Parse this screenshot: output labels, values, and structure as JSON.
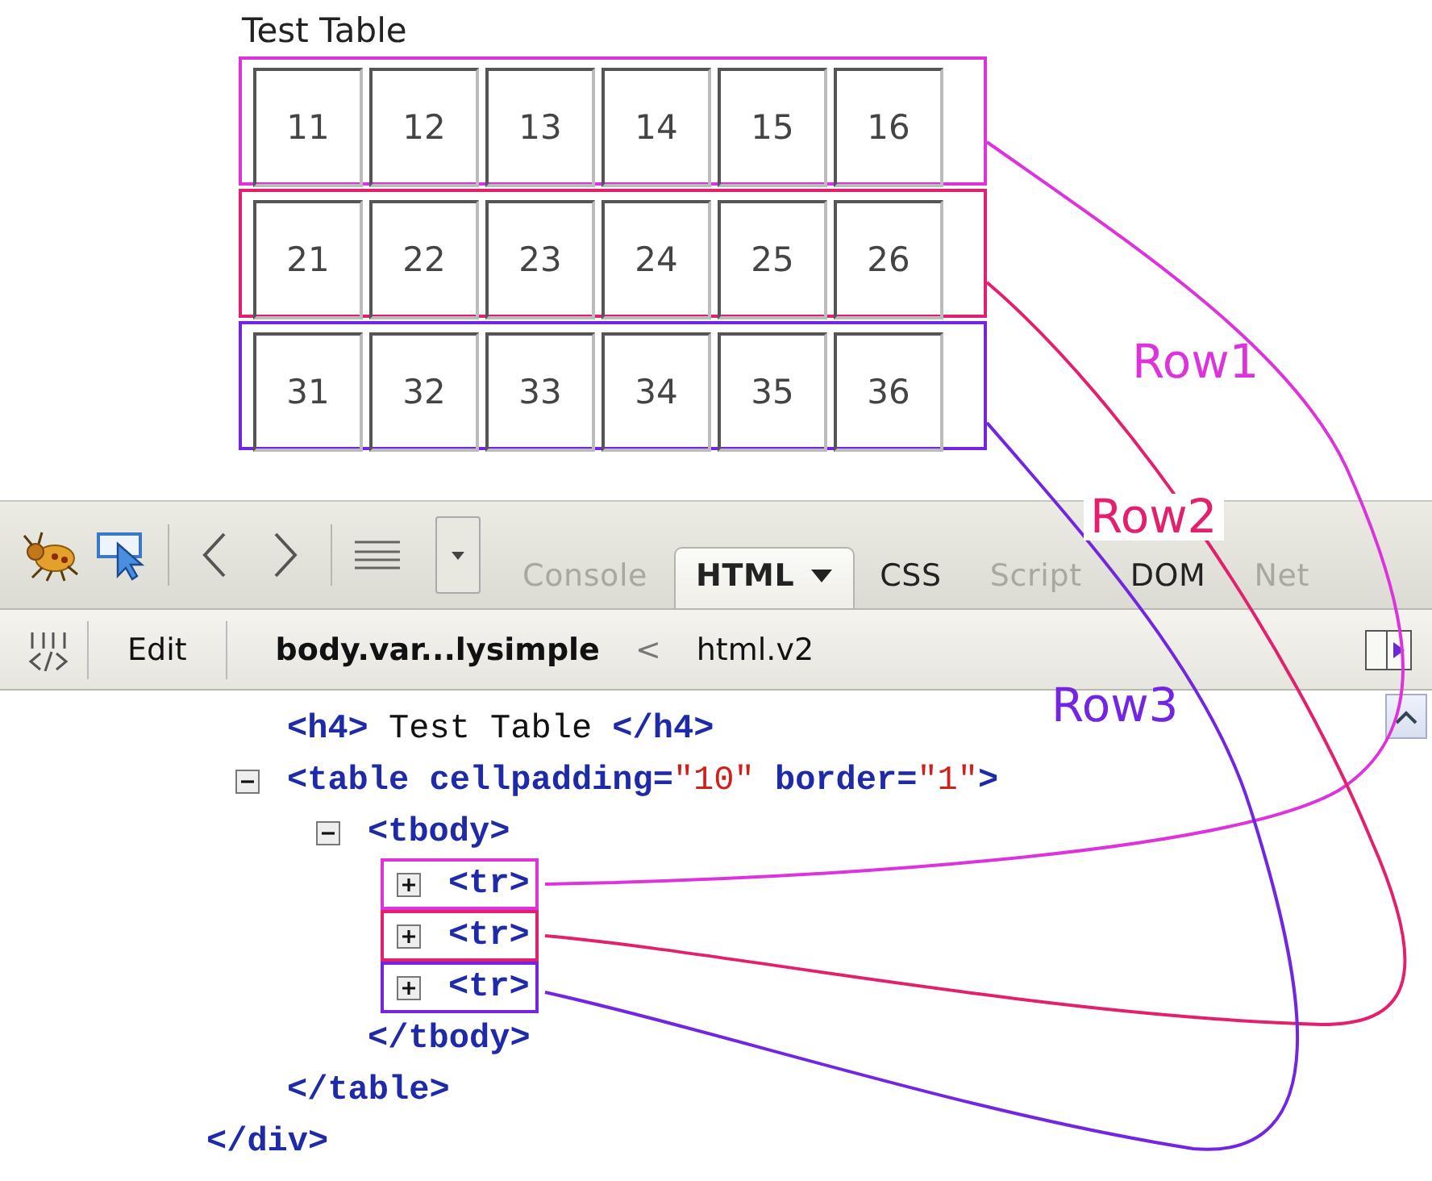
{
  "test_page": {
    "heading": "Test Table",
    "rows": [
      {
        "cells": [
          "11",
          "12",
          "13",
          "14",
          "15",
          "16"
        ]
      },
      {
        "cells": [
          "21",
          "22",
          "23",
          "24",
          "25",
          "26"
        ]
      },
      {
        "cells": [
          "31",
          "32",
          "33",
          "34",
          "35",
          "36"
        ]
      }
    ]
  },
  "toolbar": {
    "tabs": [
      {
        "label": "Console",
        "selected": false,
        "dimmed": true,
        "has_menu": false
      },
      {
        "label": "HTML",
        "selected": true,
        "dimmed": false,
        "has_menu": true
      },
      {
        "label": "CSS",
        "selected": false,
        "dimmed": false,
        "has_menu": false
      },
      {
        "label": "Script",
        "selected": false,
        "dimmed": true,
        "has_menu": false
      },
      {
        "label": "DOM",
        "selected": false,
        "dimmed": false,
        "has_menu": false
      },
      {
        "label": "Net",
        "selected": false,
        "dimmed": true,
        "has_menu": false
      }
    ]
  },
  "breadcrumbs": {
    "edit_button": "Edit",
    "crumbs": [
      "body.var...lysimple",
      "html.v2"
    ],
    "separator": "<"
  },
  "html_tree": {
    "close": [
      {
        "kind": "tag",
        "text": "</div>"
      }
    ],
    "children": [
      {
        "open": [
          {
            "kind": "tag",
            "text": "<h4>"
          },
          {
            "kind": "text",
            "text": " Test Table "
          },
          {
            "kind": "tag",
            "text": "</h4>"
          }
        ]
      },
      {
        "open": [
          {
            "kind": "tag",
            "text": "<table"
          },
          {
            "kind": "attr",
            "text": " cellpadding="
          },
          {
            "kind": "value",
            "text": "\"10\""
          },
          {
            "kind": "attr",
            "text": " border="
          },
          {
            "kind": "value",
            "text": "\"1\""
          },
          {
            "kind": "tag",
            "text": ">"
          }
        ],
        "expanded": true,
        "close": [
          {
            "kind": "tag",
            "text": "</table>"
          }
        ],
        "children": [
          {
            "open": [
              {
                "kind": "tag",
                "text": "<tbody>"
              }
            ],
            "expanded": true,
            "close": [
              {
                "kind": "tag",
                "text": "</tbody>"
              }
            ],
            "children": [
              {
                "open": [
                  {
                    "kind": "tag",
                    "text": "<tr>"
                  }
                ],
                "expanded": false,
                "annotated": true
              },
              {
                "open": [
                  {
                    "kind": "tag",
                    "text": "<tr>"
                  }
                ],
                "expanded": false,
                "annotated": true
              },
              {
                "open": [
                  {
                    "kind": "tag",
                    "text": "<tr>"
                  }
                ],
                "expanded": false,
                "annotated": true
              }
            ]
          }
        ]
      }
    ]
  },
  "annotations": [
    {
      "label": "Row1",
      "color": "#dd33dd"
    },
    {
      "label": "Row2",
      "color": "#e3206e"
    },
    {
      "label": "Row3",
      "color": "#7326e0"
    }
  ]
}
